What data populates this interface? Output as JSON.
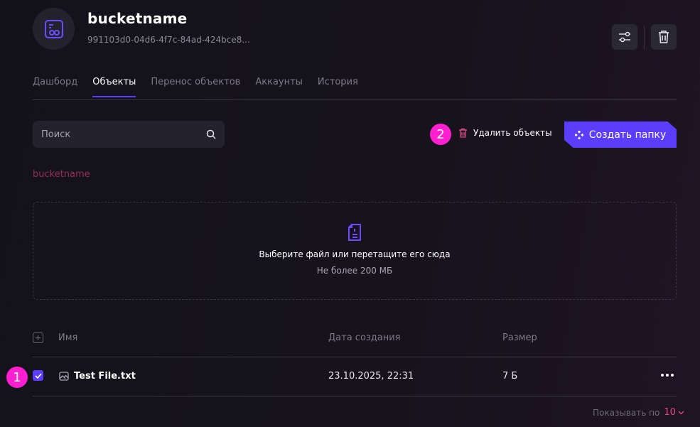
{
  "bucket": {
    "name": "bucketname",
    "id": "991103d0-04d6-4f7c-84ad-424bce8..."
  },
  "tabs": [
    {
      "label": "Дашборд",
      "active": false
    },
    {
      "label": "Объекты",
      "active": true
    },
    {
      "label": "Перенос объектов",
      "active": false
    },
    {
      "label": "Аккаунты",
      "active": false
    },
    {
      "label": "История",
      "active": false
    }
  ],
  "search": {
    "placeholder": "Поиск",
    "value": ""
  },
  "actions": {
    "delete_objects_label": "Удалить объекты",
    "create_folder_label": "Создать папку"
  },
  "breadcrumb": "bucketname",
  "dropzone": {
    "title": "Выберите файл или перетащите его сюда",
    "subtitle": "Не более 200 МБ"
  },
  "table": {
    "columns": [
      "Имя",
      "Дата создания",
      "Размер"
    ],
    "rows": [
      {
        "name": "Test File.txt",
        "created": "23.10.2025, 22:31",
        "size": "7 Б",
        "checked": true
      }
    ]
  },
  "pagination": {
    "label": "Показывать по",
    "value": "10"
  },
  "annotations": [
    "1",
    "2"
  ],
  "colors": {
    "accent": "#5b3dfb",
    "danger": "#e24a87",
    "breadcrumb": "#9c2c5c",
    "badge": "#ff1fd0"
  },
  "icons": [
    "bucket-icon",
    "settings-sliders-icon",
    "trash-icon",
    "search-icon",
    "document-icon",
    "image-file-icon",
    "check-icon",
    "plus-icon",
    "sparkle-icon",
    "chevron-down-icon",
    "more-icon"
  ]
}
